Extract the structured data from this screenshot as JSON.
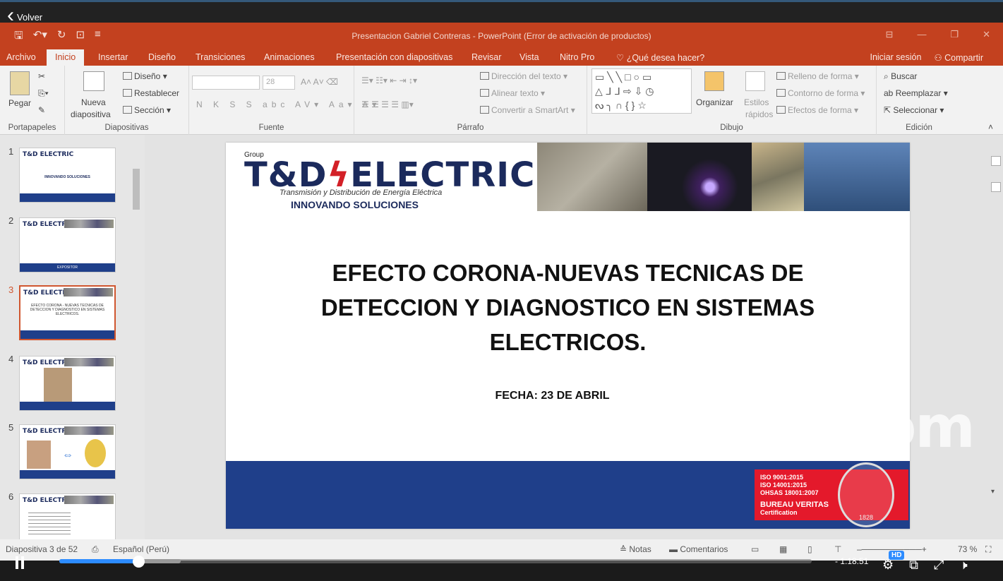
{
  "player": {
    "back_label": "Volver",
    "time": "- 1:18:51",
    "hd": "HD",
    "progress_fraction": 0.105,
    "buffer_fraction": 0.161
  },
  "app": {
    "title": "Presentacion Gabriel Contreras - PowerPoint (Error de activación de productos)",
    "tabs": [
      "Archivo",
      "Inicio",
      "Insertar",
      "Diseño",
      "Transiciones",
      "Animaciones",
      "Presentación con diapositivas",
      "Revisar",
      "Vista",
      "Nitro Pro",
      "¿Qué desea hacer?"
    ],
    "active_tab": "Inicio",
    "signin": "Iniciar sesión",
    "share": "Compartir"
  },
  "ribbon": {
    "portapapeles": {
      "pegar": "Pegar",
      "label": "Portapapeles"
    },
    "diapositivas": {
      "nueva": "Nueva",
      "nueva2": "diapositiva",
      "diseno": "Diseño",
      "restablecer": "Restablecer",
      "seccion": "Sección",
      "label": "Diapositivas"
    },
    "fuente": {
      "size": "28",
      "label": "Fuente"
    },
    "parrafo": {
      "direccion": "Dirección del texto",
      "alinear": "Alinear texto",
      "smartart": "Convertir a SmartArt",
      "label": "Párrafo"
    },
    "dibujo": {
      "organizar": "Organizar",
      "estilos": "Estilos",
      "rapidos": "rápidos",
      "relleno": "Relleno de forma",
      "contorno": "Contorno de forma",
      "efectos": "Efectos de forma",
      "label": "Dibujo"
    },
    "edicion": {
      "buscar": "Buscar",
      "reemplazar": "Reemplazar",
      "seleccionar": "Seleccionar",
      "label": "Edición"
    }
  },
  "thumbnails": [
    {
      "num": "1",
      "logo": "T&D ELECTRIC",
      "caption": "INNOVANDO SOLUCIONES"
    },
    {
      "num": "2",
      "logo": "T&D ELECTRIC",
      "caption": "EXPOSITOR"
    },
    {
      "num": "3",
      "logo": "T&D ELECTRIC",
      "caption": "EFECTO CORONA - NUEVAS TECNICAS DE DETECCION Y DIAGNOSTICO EN SISTEMAS ELECTRICOS."
    },
    {
      "num": "4",
      "logo": "T&D ELECTRIC",
      "caption": ""
    },
    {
      "num": "5",
      "logo": "T&D ELECTRIC",
      "caption": ""
    },
    {
      "num": "6",
      "logo": "T&D ELECTRIC",
      "caption": ""
    }
  ],
  "slide": {
    "group": "Group",
    "logo_a": "T&D",
    "logo_b": "ELECTRIC",
    "logo_sub": "Transmisión y Distribución de Energía Eléctrica",
    "logo_tag": "INNOVANDO SOLUCIONES",
    "title": "EFECTO CORONA-NUEVAS TECNICAS DE DETECCION Y DIAGNOSTICO EN SISTEMAS ELECTRICOS.",
    "date": "FECHA: 23 DE ABRIL",
    "cert": [
      "ISO 9001:2015",
      "ISO 14001:2015",
      "OHSAS 18001:2007"
    ],
    "cert_brand": "BUREAU VERITAS",
    "cert_sub": "Certification",
    "seal_year": "1828",
    "band_color": "#1f3f8a"
  },
  "status": {
    "slide": "Diapositiva 3 de 52",
    "lang": "Español (Perú)",
    "notas": "Notas",
    "comentarios": "Comentarios",
    "zoom": "73 %"
  },
  "watermark": "zoom",
  "colors": {
    "ppt_accent": "#c3411f",
    "zoom_blue": "#2d8cff"
  }
}
